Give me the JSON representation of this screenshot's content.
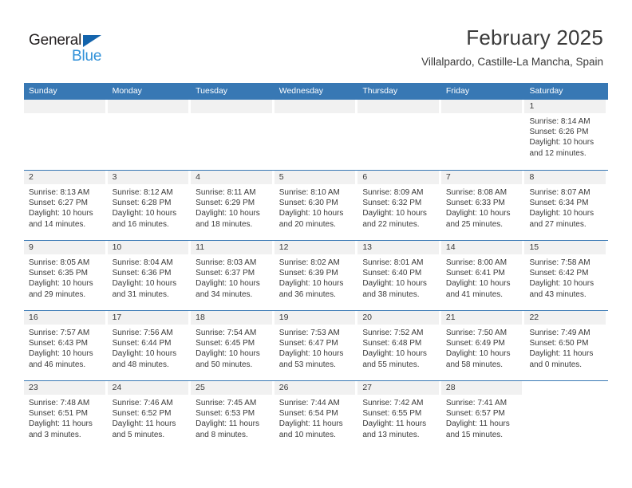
{
  "brand": {
    "name_part1": "General",
    "name_part2": "Blue",
    "triangle_icon": "triangle-icon",
    "colors": {
      "dark": "#231f20",
      "blue": "#2f90d8",
      "triangle": "#1464ac"
    }
  },
  "header": {
    "title": "February 2025",
    "subtitle": "Villalpardo, Castille-La Mancha, Spain"
  },
  "calendar": {
    "accent_color": "#3878b4",
    "day_band_color": "#f1f1f1",
    "weekdays": [
      "Sunday",
      "Monday",
      "Tuesday",
      "Wednesday",
      "Thursday",
      "Friday",
      "Saturday"
    ],
    "weeks": [
      [
        {
          "date": "",
          "sunrise": "",
          "sunset": "",
          "daylight1": "",
          "daylight2": "",
          "empty": true,
          "band": true
        },
        {
          "date": "",
          "sunrise": "",
          "sunset": "",
          "daylight1": "",
          "daylight2": "",
          "empty": true,
          "band": true
        },
        {
          "date": "",
          "sunrise": "",
          "sunset": "",
          "daylight1": "",
          "daylight2": "",
          "empty": true,
          "band": true
        },
        {
          "date": "",
          "sunrise": "",
          "sunset": "",
          "daylight1": "",
          "daylight2": "",
          "empty": true,
          "band": true
        },
        {
          "date": "",
          "sunrise": "",
          "sunset": "",
          "daylight1": "",
          "daylight2": "",
          "empty": true,
          "band": true
        },
        {
          "date": "",
          "sunrise": "",
          "sunset": "",
          "daylight1": "",
          "daylight2": "",
          "empty": true,
          "band": true
        },
        {
          "date": "1",
          "sunrise": "Sunrise: 8:14 AM",
          "sunset": "Sunset: 6:26 PM",
          "daylight1": "Daylight: 10 hours",
          "daylight2": "and 12 minutes."
        }
      ],
      [
        {
          "date": "2",
          "sunrise": "Sunrise: 8:13 AM",
          "sunset": "Sunset: 6:27 PM",
          "daylight1": "Daylight: 10 hours",
          "daylight2": "and 14 minutes."
        },
        {
          "date": "3",
          "sunrise": "Sunrise: 8:12 AM",
          "sunset": "Sunset: 6:28 PM",
          "daylight1": "Daylight: 10 hours",
          "daylight2": "and 16 minutes."
        },
        {
          "date": "4",
          "sunrise": "Sunrise: 8:11 AM",
          "sunset": "Sunset: 6:29 PM",
          "daylight1": "Daylight: 10 hours",
          "daylight2": "and 18 minutes."
        },
        {
          "date": "5",
          "sunrise": "Sunrise: 8:10 AM",
          "sunset": "Sunset: 6:30 PM",
          "daylight1": "Daylight: 10 hours",
          "daylight2": "and 20 minutes."
        },
        {
          "date": "6",
          "sunrise": "Sunrise: 8:09 AM",
          "sunset": "Sunset: 6:32 PM",
          "daylight1": "Daylight: 10 hours",
          "daylight2": "and 22 minutes."
        },
        {
          "date": "7",
          "sunrise": "Sunrise: 8:08 AM",
          "sunset": "Sunset: 6:33 PM",
          "daylight1": "Daylight: 10 hours",
          "daylight2": "and 25 minutes."
        },
        {
          "date": "8",
          "sunrise": "Sunrise: 8:07 AM",
          "sunset": "Sunset: 6:34 PM",
          "daylight1": "Daylight: 10 hours",
          "daylight2": "and 27 minutes."
        }
      ],
      [
        {
          "date": "9",
          "sunrise": "Sunrise: 8:05 AM",
          "sunset": "Sunset: 6:35 PM",
          "daylight1": "Daylight: 10 hours",
          "daylight2": "and 29 minutes."
        },
        {
          "date": "10",
          "sunrise": "Sunrise: 8:04 AM",
          "sunset": "Sunset: 6:36 PM",
          "daylight1": "Daylight: 10 hours",
          "daylight2": "and 31 minutes."
        },
        {
          "date": "11",
          "sunrise": "Sunrise: 8:03 AM",
          "sunset": "Sunset: 6:37 PM",
          "daylight1": "Daylight: 10 hours",
          "daylight2": "and 34 minutes."
        },
        {
          "date": "12",
          "sunrise": "Sunrise: 8:02 AM",
          "sunset": "Sunset: 6:39 PM",
          "daylight1": "Daylight: 10 hours",
          "daylight2": "and 36 minutes."
        },
        {
          "date": "13",
          "sunrise": "Sunrise: 8:01 AM",
          "sunset": "Sunset: 6:40 PM",
          "daylight1": "Daylight: 10 hours",
          "daylight2": "and 38 minutes."
        },
        {
          "date": "14",
          "sunrise": "Sunrise: 8:00 AM",
          "sunset": "Sunset: 6:41 PM",
          "daylight1": "Daylight: 10 hours",
          "daylight2": "and 41 minutes."
        },
        {
          "date": "15",
          "sunrise": "Sunrise: 7:58 AM",
          "sunset": "Sunset: 6:42 PM",
          "daylight1": "Daylight: 10 hours",
          "daylight2": "and 43 minutes."
        }
      ],
      [
        {
          "date": "16",
          "sunrise": "Sunrise: 7:57 AM",
          "sunset": "Sunset: 6:43 PM",
          "daylight1": "Daylight: 10 hours",
          "daylight2": "and 46 minutes."
        },
        {
          "date": "17",
          "sunrise": "Sunrise: 7:56 AM",
          "sunset": "Sunset: 6:44 PM",
          "daylight1": "Daylight: 10 hours",
          "daylight2": "and 48 minutes."
        },
        {
          "date": "18",
          "sunrise": "Sunrise: 7:54 AM",
          "sunset": "Sunset: 6:45 PM",
          "daylight1": "Daylight: 10 hours",
          "daylight2": "and 50 minutes."
        },
        {
          "date": "19",
          "sunrise": "Sunrise: 7:53 AM",
          "sunset": "Sunset: 6:47 PM",
          "daylight1": "Daylight: 10 hours",
          "daylight2": "and 53 minutes."
        },
        {
          "date": "20",
          "sunrise": "Sunrise: 7:52 AM",
          "sunset": "Sunset: 6:48 PM",
          "daylight1": "Daylight: 10 hours",
          "daylight2": "and 55 minutes."
        },
        {
          "date": "21",
          "sunrise": "Sunrise: 7:50 AM",
          "sunset": "Sunset: 6:49 PM",
          "daylight1": "Daylight: 10 hours",
          "daylight2": "and 58 minutes."
        },
        {
          "date": "22",
          "sunrise": "Sunrise: 7:49 AM",
          "sunset": "Sunset: 6:50 PM",
          "daylight1": "Daylight: 11 hours",
          "daylight2": "and 0 minutes."
        }
      ],
      [
        {
          "date": "23",
          "sunrise": "Sunrise: 7:48 AM",
          "sunset": "Sunset: 6:51 PM",
          "daylight1": "Daylight: 11 hours",
          "daylight2": "and 3 minutes."
        },
        {
          "date": "24",
          "sunrise": "Sunrise: 7:46 AM",
          "sunset": "Sunset: 6:52 PM",
          "daylight1": "Daylight: 11 hours",
          "daylight2": "and 5 minutes."
        },
        {
          "date": "25",
          "sunrise": "Sunrise: 7:45 AM",
          "sunset": "Sunset: 6:53 PM",
          "daylight1": "Daylight: 11 hours",
          "daylight2": "and 8 minutes."
        },
        {
          "date": "26",
          "sunrise": "Sunrise: 7:44 AM",
          "sunset": "Sunset: 6:54 PM",
          "daylight1": "Daylight: 11 hours",
          "daylight2": "and 10 minutes."
        },
        {
          "date": "27",
          "sunrise": "Sunrise: 7:42 AM",
          "sunset": "Sunset: 6:55 PM",
          "daylight1": "Daylight: 11 hours",
          "daylight2": "and 13 minutes."
        },
        {
          "date": "28",
          "sunrise": "Sunrise: 7:41 AM",
          "sunset": "Sunset: 6:57 PM",
          "daylight1": "Daylight: 11 hours",
          "daylight2": "and 15 minutes."
        },
        {
          "date": "",
          "sunrise": "",
          "sunset": "",
          "daylight1": "",
          "daylight2": "",
          "empty": true,
          "band": false
        }
      ]
    ]
  }
}
